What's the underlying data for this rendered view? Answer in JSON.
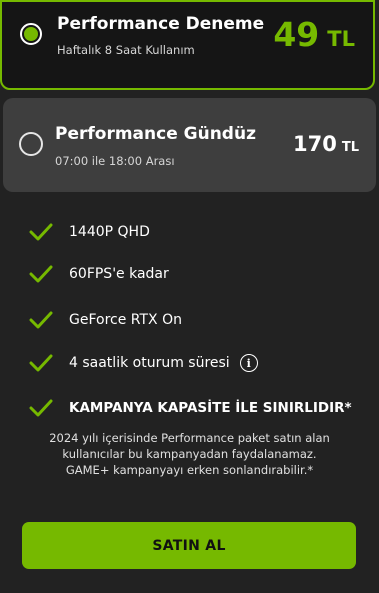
{
  "plans": [
    {
      "title": "Performance Deneme",
      "subtitle": "Haftalık 8 Saat Kullanım",
      "price": "49",
      "currency": "TL",
      "selected": true
    },
    {
      "title": "Performance Gündüz",
      "subtitle": "07:00 ile 18:00 Arası",
      "price": "170",
      "currency": "TL",
      "selected": false
    }
  ],
  "features": [
    {
      "label": "1440P QHD",
      "icon": "check-icon"
    },
    {
      "label": "60FPS'e kadar",
      "icon": "check-icon"
    },
    {
      "label": "GeForce RTX On",
      "icon": "check-icon"
    },
    {
      "label": "4 saatlik oturum süresi",
      "icon": "check-icon",
      "info_icon": "i"
    },
    {
      "label": "KAMPANYA KAPASİTE İLE SINIRLIDIR*",
      "icon": "check-icon"
    }
  ],
  "notice": {
    "line1": "2024 yılı içerisinde Performance paket satın alan",
    "line2": "kullanıcılar bu kampanyadan faydalanamaz.",
    "line3": "GAME+ kampanyayı erken sonlandırabilir.*"
  },
  "cta": {
    "label": "SATIN AL"
  },
  "colors": {
    "accent": "#76b900",
    "background": "#222222",
    "card": "#3e3e3e"
  }
}
